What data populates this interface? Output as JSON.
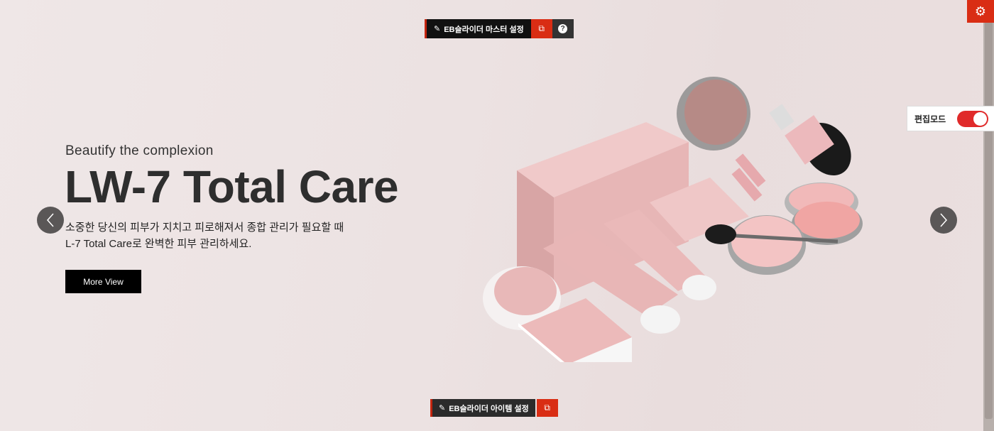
{
  "toolbar": {
    "master_settings_label": "EB슬라이더 마스터 설정",
    "item_settings_label": "EB슬라이더 아이템 설정",
    "help_symbol": "?"
  },
  "edit_mode": {
    "label": "편집모드",
    "enabled": true
  },
  "slide": {
    "subtitle": "Beautify the complexion",
    "title": "LW-7 Total Care",
    "description_line1": "소중한 당신의 피부가 지치고 피로해져서 종합 관리가 필요할 때",
    "description_line2": "L-7 Total Care로 완벽한 피부 관리하세요.",
    "button_label": "More View"
  },
  "colors": {
    "accent_red": "#d92d14",
    "toggle_on": "#e02a2a",
    "product_pink": "#e8b6b6"
  },
  "icons": {
    "edit": "edit-icon",
    "external": "external-link-icon",
    "help": "help-icon",
    "gear": "gear-icon",
    "prev": "chevron-left-icon",
    "next": "chevron-right-icon"
  }
}
